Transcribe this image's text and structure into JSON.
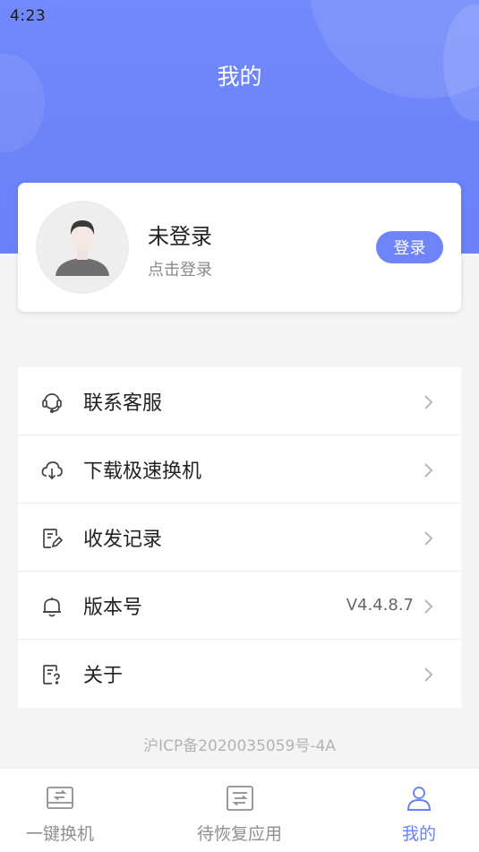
{
  "status_bar": {
    "time": "4:23"
  },
  "header": {
    "title": "我的"
  },
  "profile": {
    "name": "未登录",
    "subtitle": "点击登录",
    "login_button": "登录"
  },
  "menu": {
    "items": [
      {
        "label": "联系客服",
        "icon": "headset-icon",
        "value": ""
      },
      {
        "label": "下载极速换机",
        "icon": "cloud-download-icon",
        "value": ""
      },
      {
        "label": "收发记录",
        "icon": "edit-document-icon",
        "value": ""
      },
      {
        "label": "版本号",
        "icon": "bell-icon",
        "value": "V4.4.8.7"
      },
      {
        "label": "关于",
        "icon": "help-document-icon",
        "value": ""
      }
    ]
  },
  "footer": {
    "icp": "沪ICP备2020035059号-4A"
  },
  "tabbar": {
    "tabs": [
      {
        "label": "一键换机",
        "icon": "phone-transfer-icon",
        "active": false
      },
      {
        "label": "待恢复应用",
        "icon": "restore-app-icon",
        "active": false
      },
      {
        "label": "我的",
        "icon": "user-icon",
        "active": true
      }
    ]
  },
  "colors": {
    "accent": "#6a80f7",
    "header_gradient_top": "#7089fb",
    "background": "#f3f4f6"
  }
}
